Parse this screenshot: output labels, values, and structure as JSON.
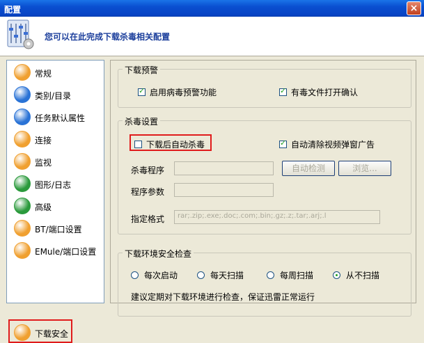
{
  "window": {
    "title": "配置",
    "close": "×"
  },
  "header": {
    "text": "您可以在此完成下载杀毒相关配置"
  },
  "sidebar": {
    "items": [
      {
        "label": "常规",
        "color": "#f0a030"
      },
      {
        "label": "类别/目录",
        "color": "#2a73d6"
      },
      {
        "label": "任务默认属性",
        "color": "#2a73d6"
      },
      {
        "label": "连接",
        "color": "#f0a030"
      },
      {
        "label": "监视",
        "color": "#f0a030"
      },
      {
        "label": "图形/日志",
        "color": "#2b9a3c"
      },
      {
        "label": "高级",
        "color": "#2b9a3c"
      },
      {
        "label": "BT/端口设置",
        "color": "#f0a030"
      },
      {
        "label": "EMule/端口设置",
        "color": "#f0a030"
      },
      {
        "label": "下载安全",
        "color": "#f0a030"
      }
    ]
  },
  "download_warning": {
    "title": "下载预警",
    "enable_virus_warning": {
      "label": "启用病毒预警功能",
      "checked": true
    },
    "open_confirm": {
      "label": "有毒文件打开确认",
      "checked": true
    }
  },
  "antivirus": {
    "title": "杀毒设置",
    "auto_scan": {
      "label": "下载后自动杀毒",
      "checked": false
    },
    "clear_ads": {
      "label": "自动清除视频弹窗广告",
      "checked": true
    },
    "program_label": "杀毒程序",
    "program_value": "",
    "auto_detect": "自动检测",
    "browse": "浏览...",
    "params_label": "程序参数",
    "params_value": "",
    "formats_label": "指定格式",
    "formats_value": "rar;.zip;.exe;.doc;.com;.bin;.gz;.z;.tar;.arj;.l"
  },
  "env_check": {
    "title": "下载环境安全检查",
    "options": [
      {
        "label": "每次启动",
        "selected": false
      },
      {
        "label": "每天扫描",
        "selected": false
      },
      {
        "label": "每周扫描",
        "selected": false
      },
      {
        "label": "从不扫描",
        "selected": true
      }
    ],
    "note": "建议定期对下载环境进行检查，保证迅雷正常运行"
  }
}
